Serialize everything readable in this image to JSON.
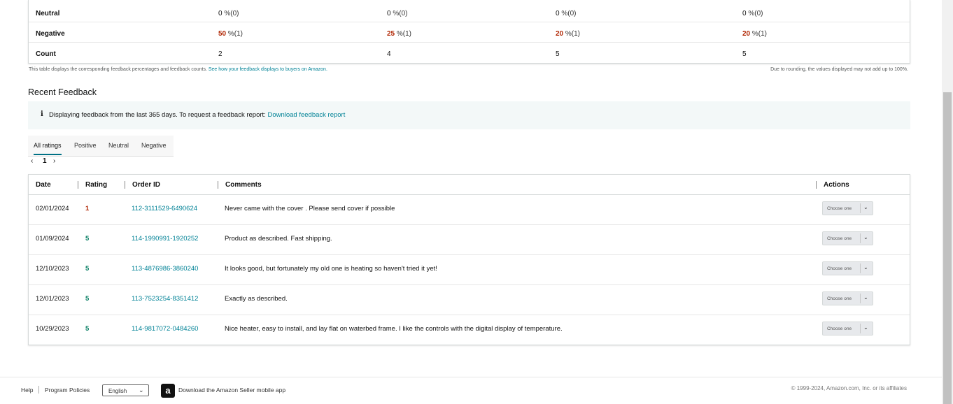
{
  "summary": {
    "rows": [
      {
        "label": "Neutral",
        "cells": [
          {
            "value": "0",
            "suffix": " %(0)",
            "highlight": false
          },
          {
            "value": "0",
            "suffix": " %(0)",
            "highlight": false
          },
          {
            "value": "0",
            "suffix": " %(0)",
            "highlight": false
          },
          {
            "value": "0",
            "suffix": " %(0)",
            "highlight": false
          }
        ]
      },
      {
        "label": "Negative",
        "cells": [
          {
            "value": "50",
            "suffix": " %(1)",
            "highlight": true
          },
          {
            "value": "25",
            "suffix": " %(1)",
            "highlight": true
          },
          {
            "value": "20",
            "suffix": " %(1)",
            "highlight": true
          },
          {
            "value": "20",
            "suffix": " %(1)",
            "highlight": true
          }
        ]
      },
      {
        "label": "Count",
        "cells": [
          {
            "value": "2",
            "suffix": "",
            "highlight": false
          },
          {
            "value": "4",
            "suffix": "",
            "highlight": false
          },
          {
            "value": "5",
            "suffix": "",
            "highlight": false
          },
          {
            "value": "5",
            "suffix": "",
            "highlight": false
          }
        ]
      }
    ],
    "note_text": "This table displays the corresponding feedback percentages and feedback counts.",
    "note_link": "See how your feedback displays to buyers on Amazon.",
    "rounding_note": "Due to rounding, the values displayed may not add up to 100%."
  },
  "recent": {
    "title": "Recent Feedback",
    "info_icon": "i",
    "info_text": "Displaying feedback from the last 365 days. To request a feedback report:",
    "info_link": "Download feedback report",
    "tabs": [
      "All ratings",
      "Positive",
      "Neutral",
      "Negative"
    ],
    "active_tab": "All ratings",
    "pager": {
      "prev": "‹",
      "page": "1",
      "next": "›"
    }
  },
  "table": {
    "headers": {
      "date": "Date",
      "rating": "Rating",
      "order_id": "Order ID",
      "comments": "Comments",
      "actions": "Actions"
    },
    "select_placeholder": "Choose one",
    "rows": [
      {
        "date": "02/01/2024",
        "rating": "1",
        "order_id": "112-3111529-6490624",
        "comment": "Never came with the cover . Please send cover if possible"
      },
      {
        "date": "01/09/2024",
        "rating": "5",
        "order_id": "114-1990991-1920252",
        "comment": "Product as described. Fast shipping."
      },
      {
        "date": "12/10/2023",
        "rating": "5",
        "order_id": "113-4876986-3860240",
        "comment": "It looks good, but fortunately my old one is heating so haven't tried it yet!"
      },
      {
        "date": "12/01/2023",
        "rating": "5",
        "order_id": "113-7523254-8351412",
        "comment": "Exactly as described."
      },
      {
        "date": "10/29/2023",
        "rating": "5",
        "order_id": "114-9817072-0484260",
        "comment": "Nice heater, easy to install, and lay flat on waterbed frame. I like the controls with the digital display of temperature."
      }
    ]
  },
  "footer": {
    "help": "Help",
    "policies": "Program Policies",
    "language": "English",
    "app_text": "Download the Amazon Seller mobile app",
    "copyright": "© 1999-2024, Amazon.com, Inc. or its affiliates"
  },
  "colors": {
    "link": "#008296",
    "negative": "#b12704",
    "positive": "#067d62"
  }
}
